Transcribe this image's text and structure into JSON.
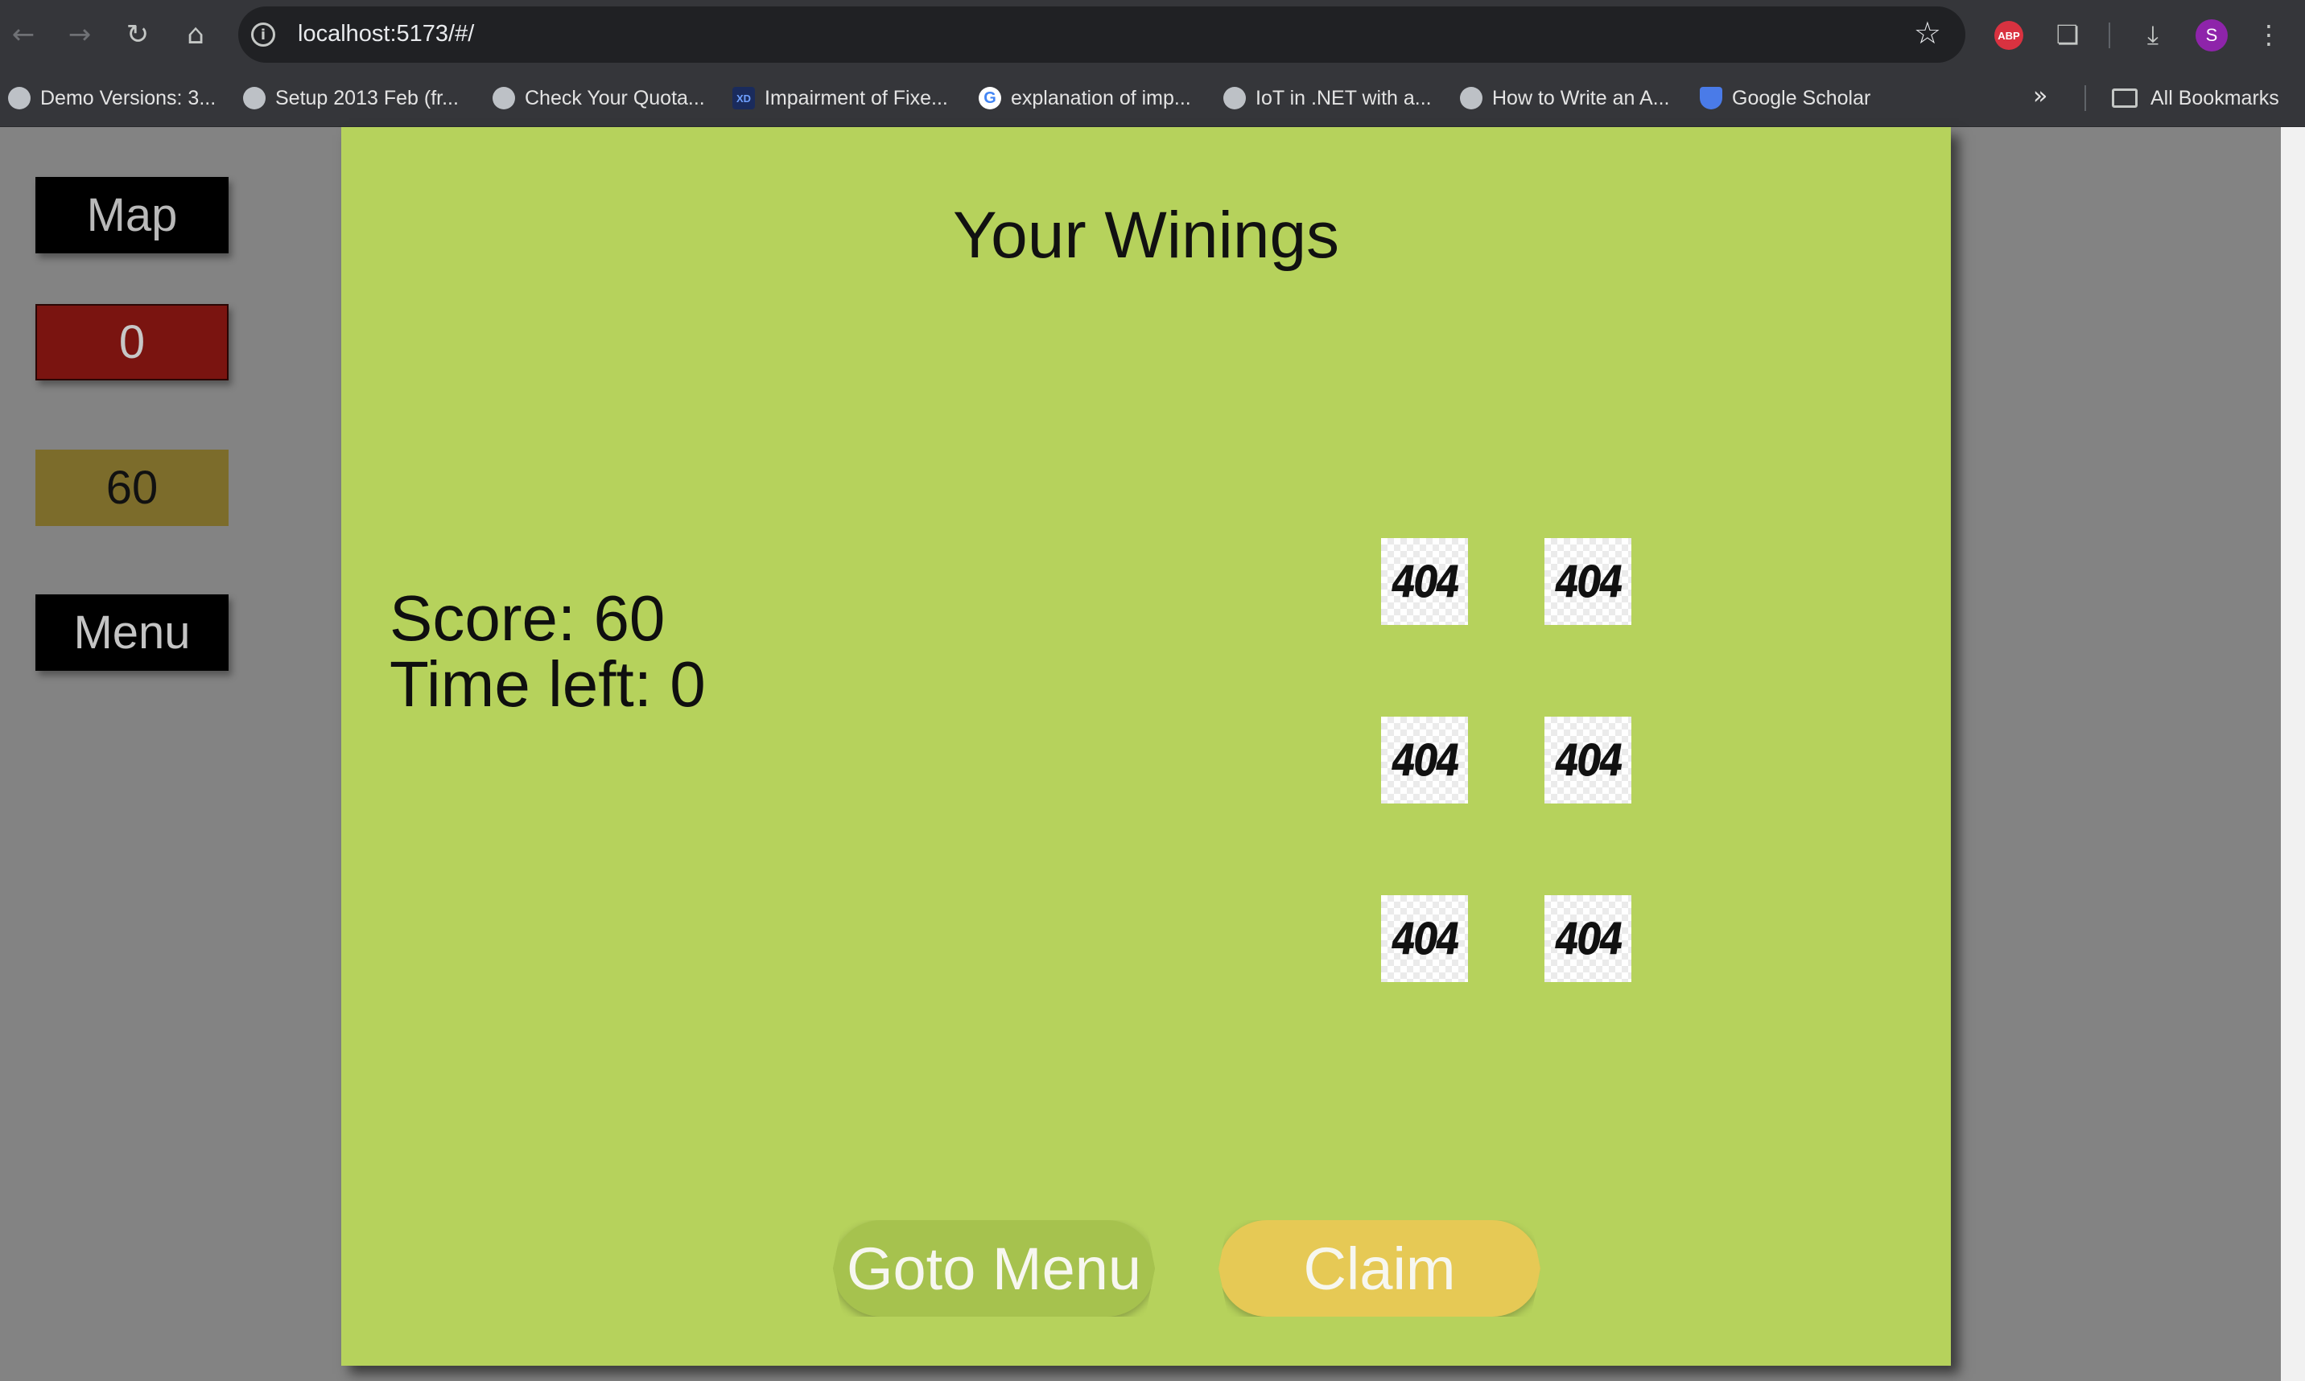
{
  "browser": {
    "url": "localhost:5173/#/",
    "avatar_letter": "S",
    "abp_label": "ABP",
    "bookmarks": [
      {
        "label": "Demo Versions: 3...",
        "icon": "globe-icon"
      },
      {
        "label": "Setup 2013 Feb (fr...",
        "icon": "globe-icon"
      },
      {
        "label": "Check Your Quota...",
        "icon": "globe-icon"
      },
      {
        "label": "Impairment of Fixe...",
        "icon": "xd-icon",
        "icon_text": "XD"
      },
      {
        "label": "explanation of imp...",
        "icon": "google-icon",
        "icon_text": "G"
      },
      {
        "label": "IoT in .NET with a...",
        "icon": "globe-icon"
      },
      {
        "label": "How to Write an A...",
        "icon": "globe-icon"
      },
      {
        "label": "Google Scholar",
        "icon": "scholar-icon"
      }
    ],
    "all_bookmarks": "All Bookmarks"
  },
  "sidebar": {
    "map_label": "Map",
    "counter_value": "0",
    "score_value": "60",
    "menu_label": "Menu"
  },
  "panel": {
    "title": "Your Winings",
    "score_line": "Score: 60",
    "time_line": "Time left: 0",
    "tiles": [
      "404",
      "404",
      "404",
      "404",
      "404",
      "404"
    ],
    "goto_menu_label": "Goto Menu",
    "claim_label": "Claim",
    "colors": {
      "panel_bg": "#b6d25c",
      "goto_menu_bg": "#a6c24e",
      "claim_bg": "#e6c955"
    }
  }
}
